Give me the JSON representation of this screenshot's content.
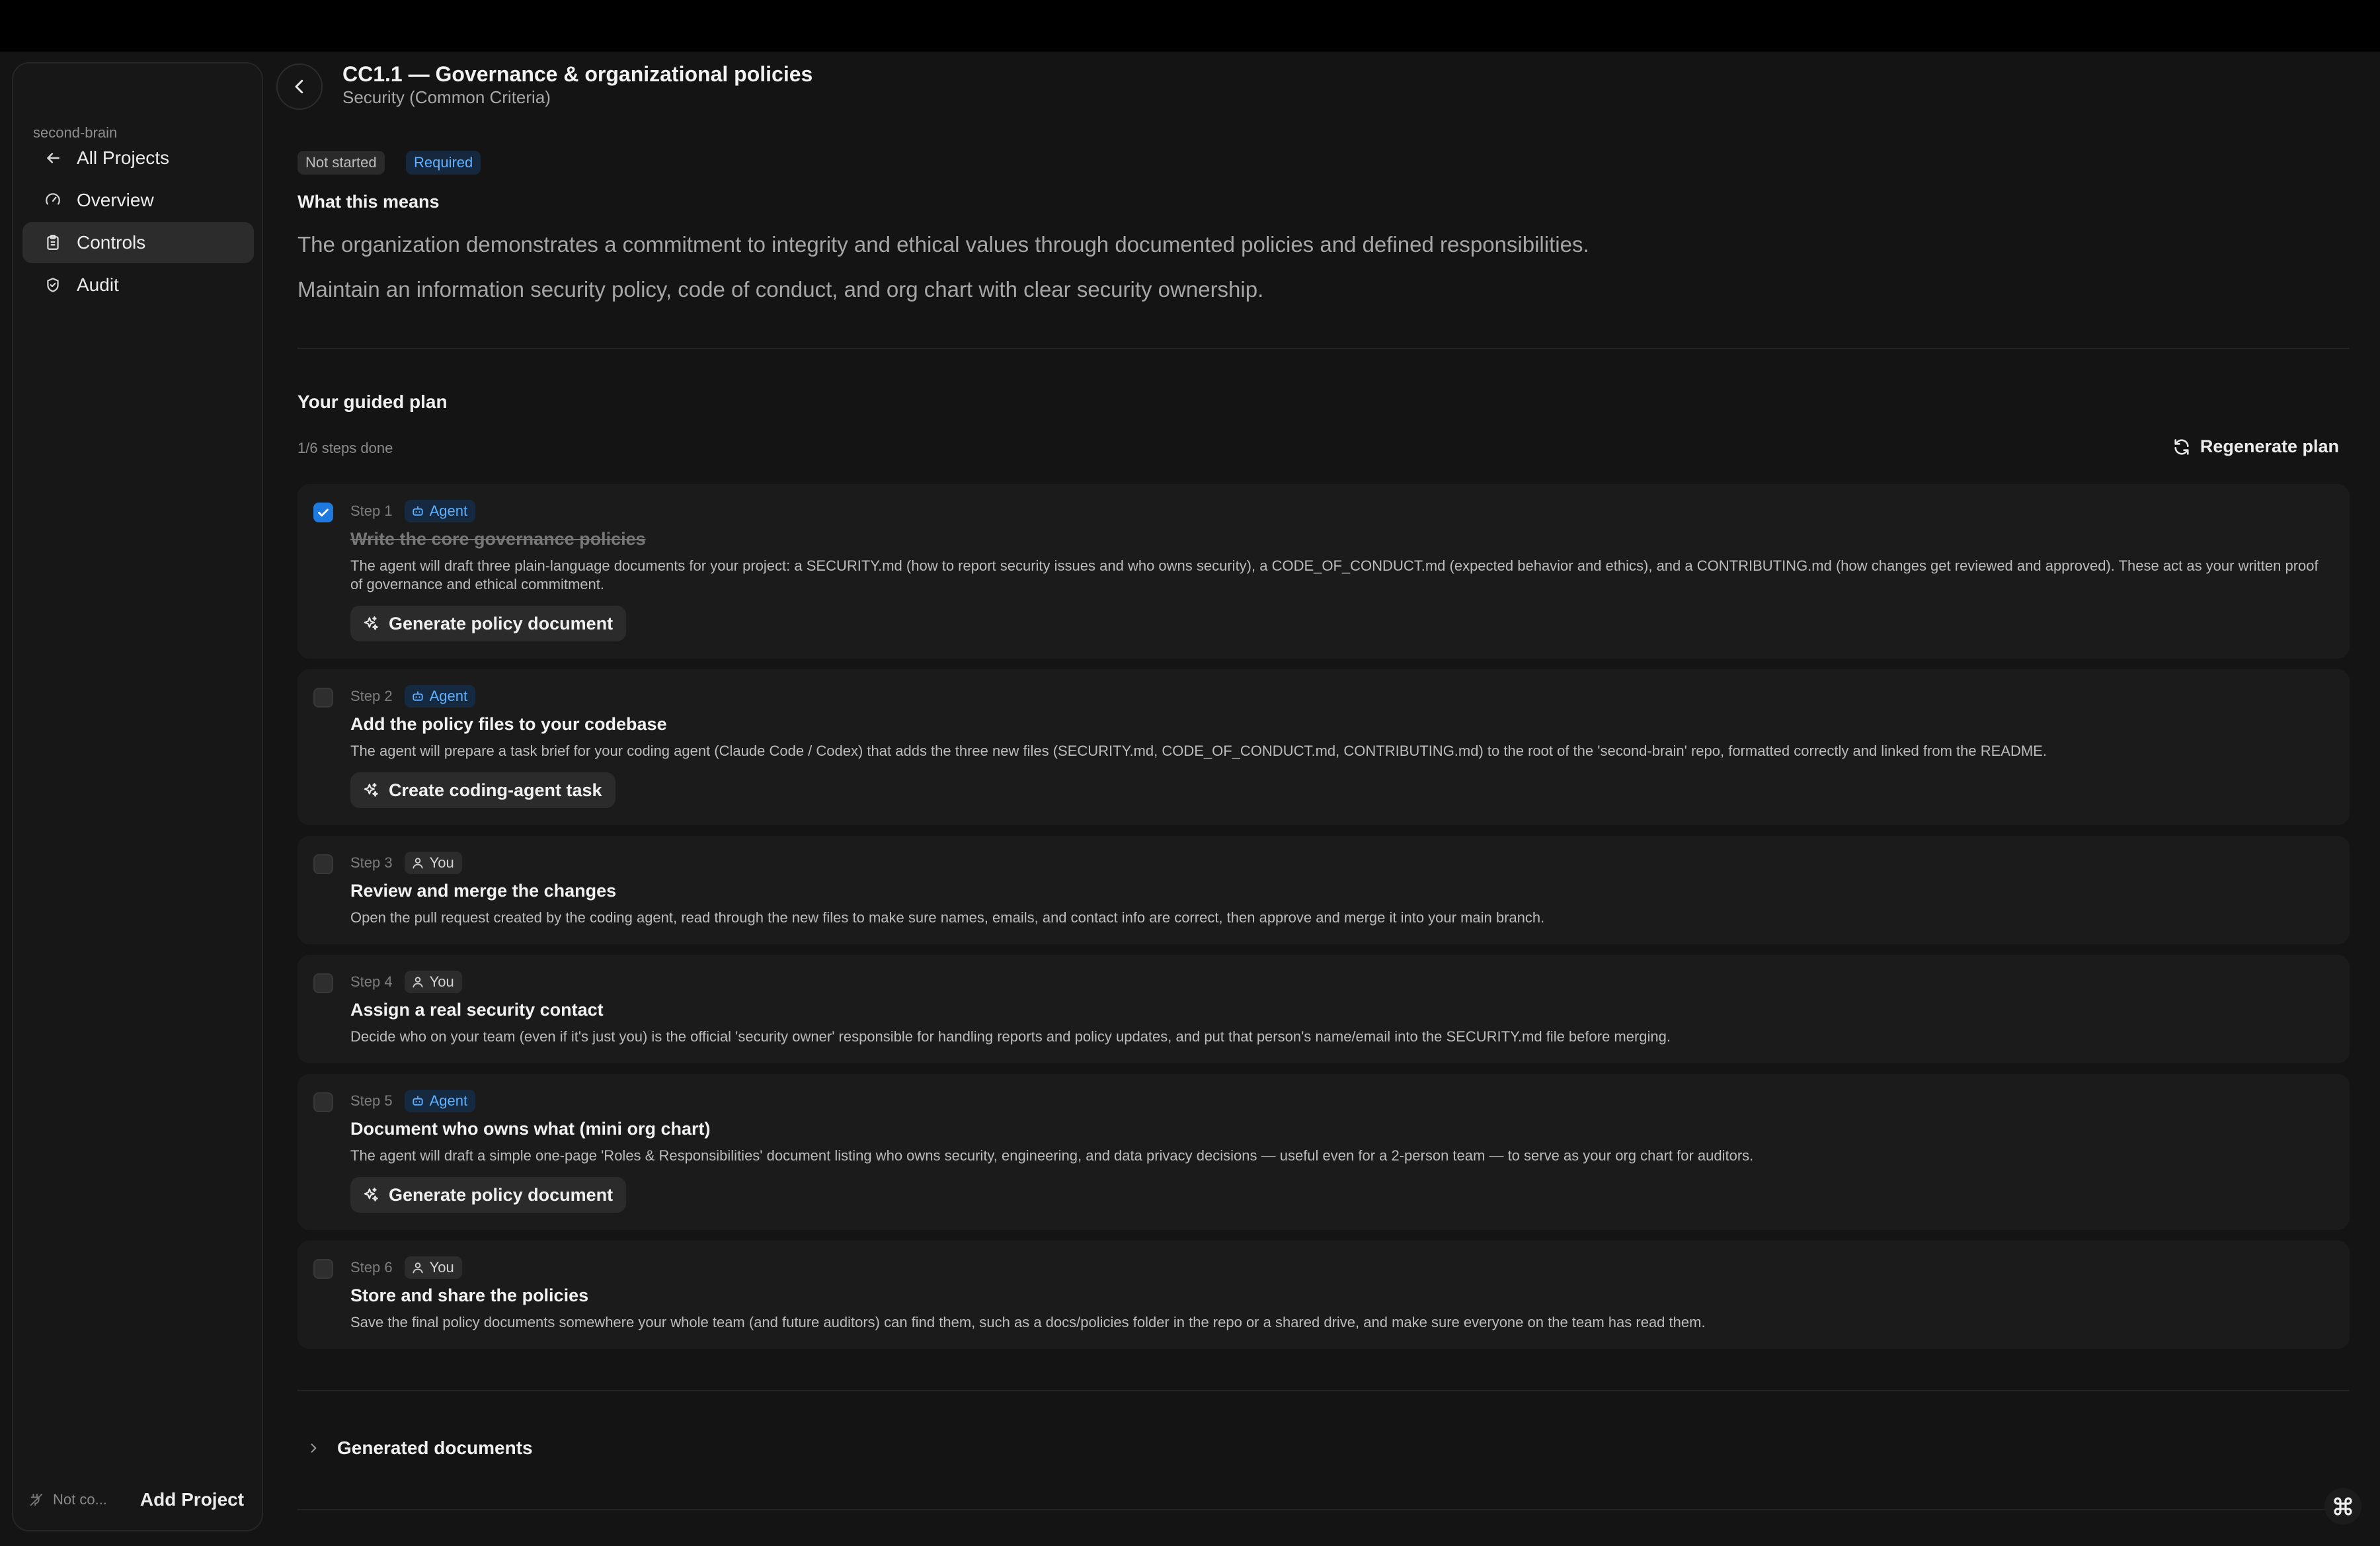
{
  "sidebar": {
    "project_name": "second-brain",
    "items": [
      {
        "label": "All Projects",
        "icon": "arrow-left-icon"
      },
      {
        "label": "Overview",
        "icon": "gauge-icon"
      },
      {
        "label": "Controls",
        "icon": "clipboard-icon",
        "active": true
      },
      {
        "label": "Audit",
        "icon": "shield-check-icon"
      }
    ],
    "status_text": "Not co...",
    "add_project_label": "Add Project"
  },
  "header": {
    "title": "CC1.1 — Governance & organizational policies",
    "subtitle": "Security (Common Criteria)"
  },
  "badges": {
    "status": "Not started",
    "requirement": "Required"
  },
  "meaning": {
    "heading": "What this means",
    "line1": "The organization demonstrates a commitment to integrity and ethical values through documented policies and defined responsibilities.",
    "line2": "Maintain an information security policy, code of conduct, and org chart with clear security ownership."
  },
  "plan": {
    "title": "Your guided plan",
    "progress": "1/6 steps done",
    "regenerate_label": "Regenerate plan",
    "steps": [
      {
        "number": "Step 1",
        "tag": "Agent",
        "done": true,
        "title": "Write the core governance policies",
        "description": "The agent will draft three plain-language documents for your project: a SECURITY.md (how to report security issues and who owns security), a CODE_OF_CONDUCT.md (expected behavior and ethics), and a CONTRIBUTING.md (how changes get reviewed and approved). These act as your written proof of governance and ethical commitment.",
        "action": "Generate policy document"
      },
      {
        "number": "Step 2",
        "tag": "Agent",
        "done": false,
        "title": "Add the policy files to your codebase",
        "description": "The agent will prepare a task brief for your coding agent (Claude Code / Codex) that adds the three new files (SECURITY.md, CODE_OF_CONDUCT.md, CONTRIBUTING.md) to the root of the 'second-brain' repo, formatted correctly and linked from the README.",
        "action": "Create coding-agent task"
      },
      {
        "number": "Step 3",
        "tag": "You",
        "done": false,
        "title": "Review and merge the changes",
        "description": "Open the pull request created by the coding agent, read through the new files to make sure names, emails, and contact info are correct, then approve and merge it into your main branch."
      },
      {
        "number": "Step 4",
        "tag": "You",
        "done": false,
        "title": "Assign a real security contact",
        "description": "Decide who on your team (even if it's just you) is the official 'security owner' responsible for handling reports and policy updates, and put that person's name/email into the SECURITY.md file before merging."
      },
      {
        "number": "Step 5",
        "tag": "Agent",
        "done": false,
        "title": "Document who owns what (mini org chart)",
        "description": "The agent will draft a simple one-page 'Roles & Responsibilities' document listing who owns security, engineering, and data privacy decisions — useful even for a 2-person team — to serve as your org chart for auditors.",
        "action": "Generate policy document"
      },
      {
        "number": "Step 6",
        "tag": "You",
        "done": false,
        "title": "Store and share the policies",
        "description": "Save the final policy documents somewhere your whole team (and future auditors) can find them, such as a docs/policies folder in the repo or a shared drive, and make sure everyone on the team has read them."
      }
    ]
  },
  "generated_documents_label": "Generated documents",
  "colors": {
    "accent": "#1f7ae0",
    "agent_tag_text": "#5fb0ff",
    "background": "#141414"
  }
}
